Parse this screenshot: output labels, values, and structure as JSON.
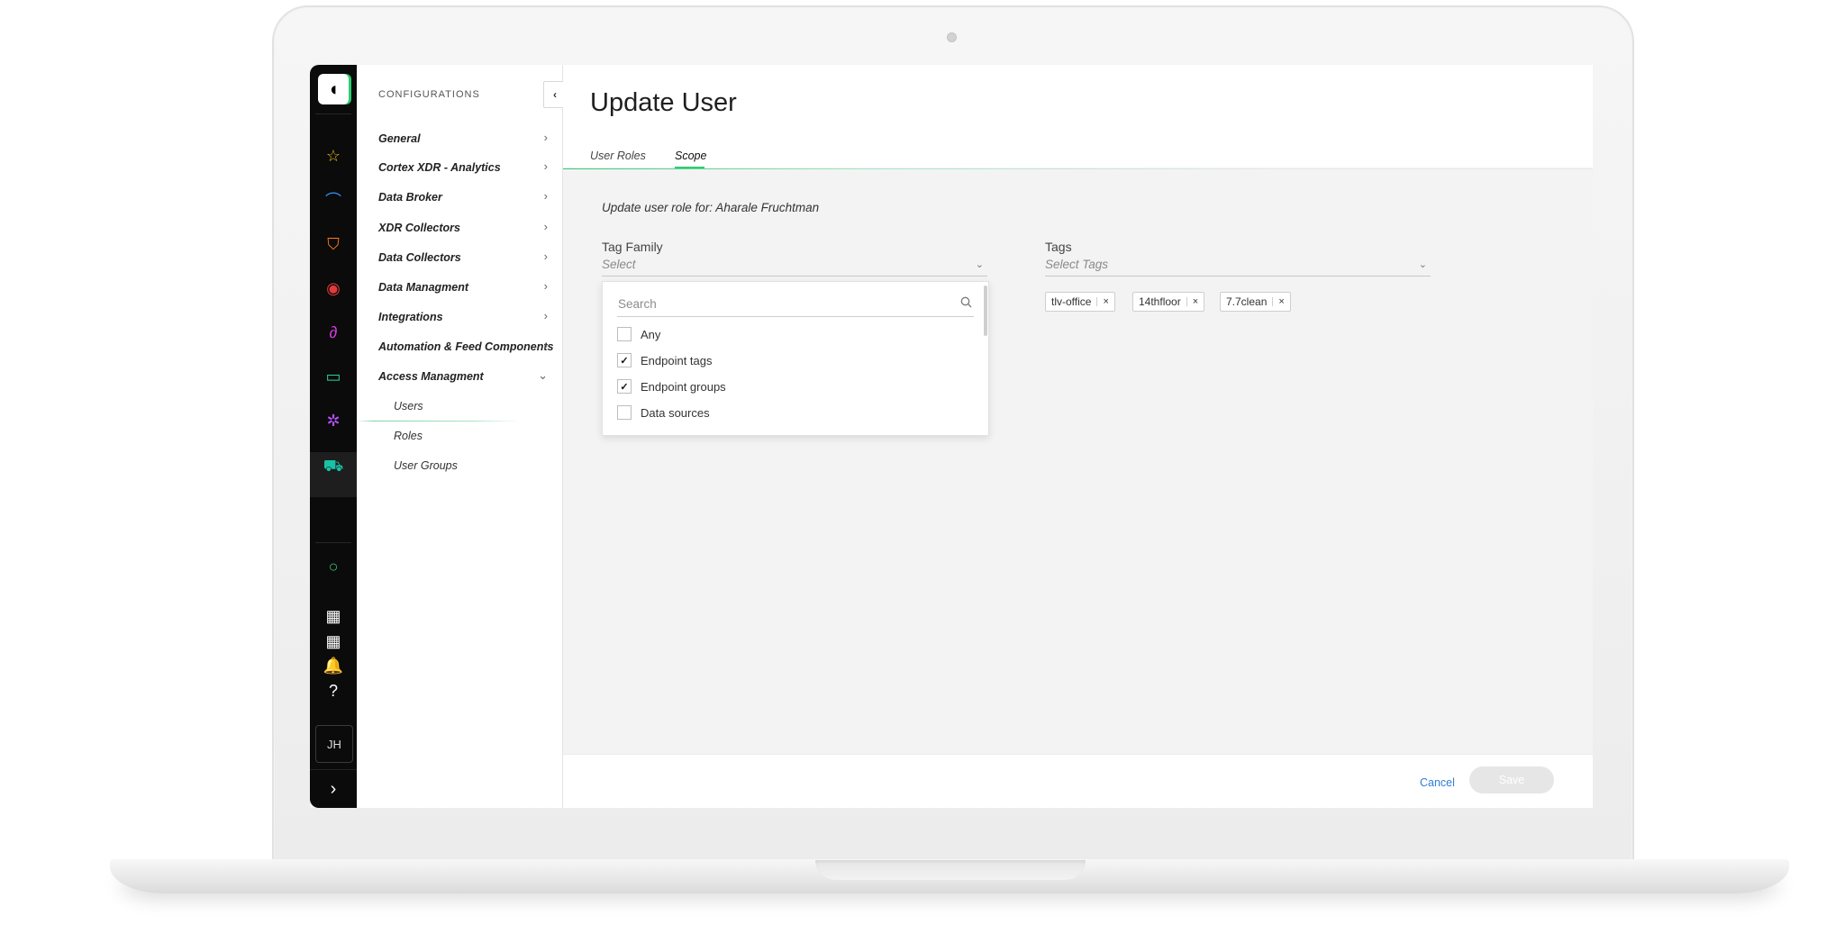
{
  "rail": {
    "logo_glyph": "◖",
    "icons": [
      {
        "name": "star-icon",
        "glyph": "☆",
        "color": "#e8c21b"
      },
      {
        "name": "signal-icon",
        "glyph": "⌒",
        "color": "#2e8ff0"
      },
      {
        "name": "shield-icon",
        "glyph": "⛉",
        "color": "#ff7a1a"
      },
      {
        "name": "eye-icon",
        "glyph": "◉",
        "color": "#e23b3b"
      },
      {
        "name": "threat-icon",
        "glyph": "∂",
        "color": "#d23bd9"
      },
      {
        "name": "monitor-icon",
        "glyph": "▭",
        "color": "#28d0a0"
      },
      {
        "name": "network-icon",
        "glyph": "✲",
        "color": "#b451ff"
      },
      {
        "name": "cart-icon",
        "glyph": "⛟",
        "color": "#19c2a7"
      },
      {
        "name": "ring-icon",
        "glyph": "○",
        "color": "#2ecc71"
      },
      {
        "name": "apps-grid-icon",
        "glyph": "▦",
        "color": "#ffffff"
      },
      {
        "name": "apps-grid-2-icon",
        "glyph": "▦",
        "color": "#ffffff"
      },
      {
        "name": "notification-icon",
        "glyph": "🔔",
        "color": "#ffffff"
      },
      {
        "name": "help-icon",
        "glyph": "?",
        "color": "#ffffff"
      }
    ],
    "avatar": "JH",
    "expand_glyph": "›"
  },
  "confnav": {
    "title": "CONFIGURATIONS",
    "collapse_glyph": "‹",
    "items": [
      {
        "label": "General",
        "chevron": "›"
      },
      {
        "label": "Cortex XDR - Analytics",
        "chevron": "›"
      },
      {
        "label": "Data Broker",
        "chevron": "›"
      },
      {
        "label": "XDR Collectors",
        "chevron": "›"
      },
      {
        "label": "Data Collectors",
        "chevron": "›"
      },
      {
        "label": "Data Managment",
        "chevron": "›"
      },
      {
        "label": "Integrations",
        "chevron": "›"
      },
      {
        "label": "Automation & Feed Components",
        "chevron": "›"
      },
      {
        "label": "Access Managment",
        "chevron": "⌄"
      }
    ],
    "subitems": [
      "Users",
      "Roles",
      "User Groups"
    ]
  },
  "main": {
    "title": "Update User",
    "tabs": [
      "User Roles",
      "Scope"
    ],
    "active_tab": "Scope",
    "description": "Update user role for: Aharale Fruchtman",
    "tag_family": {
      "label": "Tag Family",
      "placeholder": "Select",
      "search_placeholder": "Search",
      "options": [
        {
          "label": "Any",
          "checked": false
        },
        {
          "label": "Endpoint tags",
          "checked": true
        },
        {
          "label": "Endpoint groups",
          "checked": true
        },
        {
          "label": "Data sources",
          "checked": false
        }
      ]
    },
    "tags": {
      "label": "Tags",
      "placeholder": "Select Tags",
      "chips": [
        "tlv-office",
        "14thfloor",
        "7.7clean"
      ],
      "remove_glyph": "×"
    },
    "footer": {
      "cancel": "Cancel",
      "save": "Save"
    }
  },
  "colors": {
    "accent_green": "#2ecc71",
    "link_blue": "#2d7fd3",
    "rail_bg": "#0b0b0b"
  }
}
